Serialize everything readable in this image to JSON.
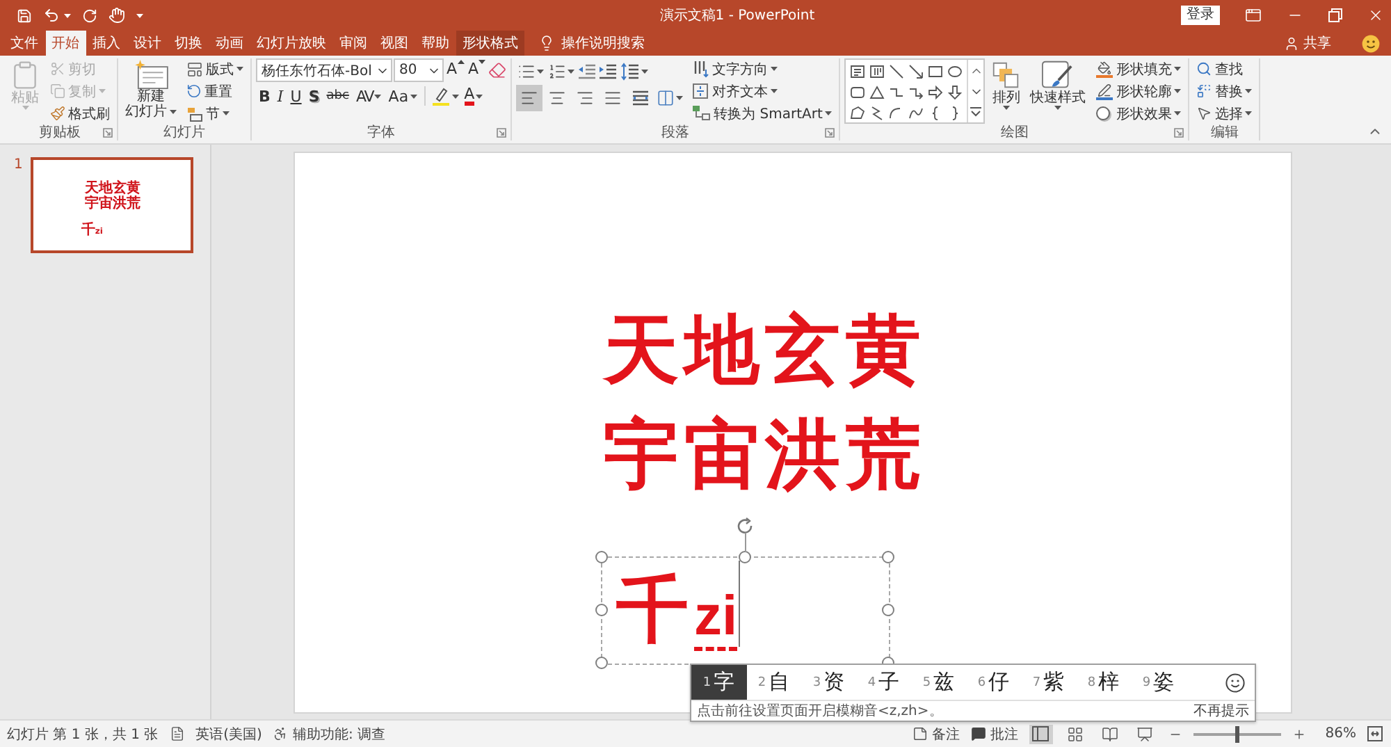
{
  "title_bar": {
    "title": "演示文稿1 - PowerPoint",
    "sign_in": "登录"
  },
  "tabs": [
    {
      "label": "文件",
      "kind": "standard",
      "selected": false
    },
    {
      "label": "开始",
      "kind": "standard",
      "selected": true
    },
    {
      "label": "插入",
      "kind": "standard",
      "selected": false
    },
    {
      "label": "设计",
      "kind": "standard",
      "selected": false
    },
    {
      "label": "切换",
      "kind": "standard",
      "selected": false
    },
    {
      "label": "动画",
      "kind": "standard",
      "selected": false
    },
    {
      "label": "幻灯片放映",
      "kind": "standard",
      "selected": false
    },
    {
      "label": "审阅",
      "kind": "standard",
      "selected": false
    },
    {
      "label": "视图",
      "kind": "standard",
      "selected": false
    },
    {
      "label": "帮助",
      "kind": "standard",
      "selected": false
    },
    {
      "label": "形状格式",
      "kind": "contextual",
      "selected": false
    }
  ],
  "tell_me": "操作说明搜索",
  "share": "共享",
  "ribbon": {
    "clipboard": {
      "label": "剪贴板",
      "paste": {
        "label": "粘贴",
        "disabled": true
      },
      "items": [
        {
          "kind": "cut",
          "label": "剪切",
          "disabled": true,
          "dropdown": false
        },
        {
          "kind": "copy",
          "label": "复制",
          "disabled": true,
          "dropdown": true
        },
        {
          "kind": "format_painter",
          "label": "格式刷",
          "disabled": false,
          "dropdown": false
        }
      ]
    },
    "slides": {
      "label": "幻灯片",
      "new_slide": [
        "新建",
        "幻灯片"
      ],
      "items": [
        {
          "kind": "layout",
          "label": "版式",
          "dropdown": true
        },
        {
          "kind": "reset",
          "label": "重置",
          "dropdown": false
        },
        {
          "kind": "section",
          "label": "节",
          "dropdown": true
        }
      ]
    },
    "font": {
      "label": "字体",
      "font_name": "杨任东竹石体-Bol",
      "font_size": "80",
      "size_buttons": [
        {
          "kind": "grow",
          "text": "A"
        },
        {
          "kind": "shrink",
          "text": "A"
        }
      ],
      "format_buttons": [
        {
          "kind": "bold",
          "text": "B",
          "dropdown": false
        },
        {
          "kind": "italic",
          "text": "I",
          "dropdown": false
        },
        {
          "kind": "underline",
          "text": "U",
          "dropdown": false
        },
        {
          "kind": "shadow",
          "text": "S",
          "dropdown": false
        },
        {
          "kind": "strikethrough",
          "text": "abc",
          "dropdown": false
        },
        {
          "kind": "spacing",
          "text": "AV",
          "dropdown": true
        },
        {
          "kind": "case",
          "text": "Aa",
          "dropdown": true
        }
      ],
      "font_color": "A"
    },
    "paragraph": {
      "label": "段落",
      "alignments": [
        {
          "kind": "left",
          "selected": true
        },
        {
          "kind": "center",
          "selected": false
        },
        {
          "kind": "right",
          "selected": false
        },
        {
          "kind": "justify",
          "selected": false
        },
        {
          "kind": "distributed",
          "selected": false
        }
      ],
      "items": [
        {
          "kind": "direction",
          "label": "文字方向"
        },
        {
          "kind": "align",
          "label": "对齐文本"
        },
        {
          "kind": "smartart",
          "label": "转换为 SmartArt"
        }
      ]
    },
    "drawing": {
      "label": "绘图",
      "arrange": "排列",
      "quick_styles": "快速样式",
      "items": [
        {
          "kind": "fill",
          "label": "形状填充"
        },
        {
          "kind": "outline",
          "label": "形状轮廓"
        },
        {
          "kind": "effects",
          "label": "形状效果"
        }
      ]
    },
    "editing": {
      "label": "编辑",
      "items": [
        {
          "kind": "find",
          "label": "查找",
          "dropdown": false
        },
        {
          "kind": "replace",
          "label": "替换",
          "dropdown": true
        },
        {
          "kind": "select",
          "label": "选择",
          "dropdown": true
        }
      ]
    }
  },
  "thumbnails": [
    {
      "number": "1",
      "selected": true,
      "lines": [
        "天地玄黄",
        "宇宙洪荒"
      ],
      "text": "千",
      "composing": "zi"
    }
  ],
  "slide": {
    "lines": [
      "天地玄黄",
      "宇宙洪荒"
    ],
    "textbox": {
      "text": "千",
      "composing": "zi"
    }
  },
  "ime": {
    "candidates": [
      {
        "number": "1",
        "text": "字",
        "selected": true
      },
      {
        "number": "2",
        "text": "自",
        "selected": false
      },
      {
        "number": "3",
        "text": "资",
        "selected": false
      },
      {
        "number": "4",
        "text": "子",
        "selected": false
      },
      {
        "number": "5",
        "text": "兹",
        "selected": false
      },
      {
        "number": "6",
        "text": "仔",
        "selected": false
      },
      {
        "number": "7",
        "text": "紫",
        "selected": false
      },
      {
        "number": "8",
        "text": "梓",
        "selected": false
      },
      {
        "number": "9",
        "text": "姿",
        "selected": false
      }
    ],
    "hint": "点击前往设置页面开启模糊音<z,zh>。",
    "dismiss": "不再提示"
  },
  "status_bar": {
    "slide_info": "幻灯片 第 1 张，共 1 张",
    "language": "英语(美国)",
    "accessibility": "辅助功能: 调查",
    "notes": "备注",
    "comments": "批注",
    "views": [
      {
        "kind": "normal",
        "selected": true
      },
      {
        "kind": "sorter",
        "selected": false
      },
      {
        "kind": "reading",
        "selected": false
      },
      {
        "kind": "slideshow",
        "selected": false
      }
    ],
    "zoom": {
      "level": 0.5,
      "reading": "86%"
    }
  }
}
